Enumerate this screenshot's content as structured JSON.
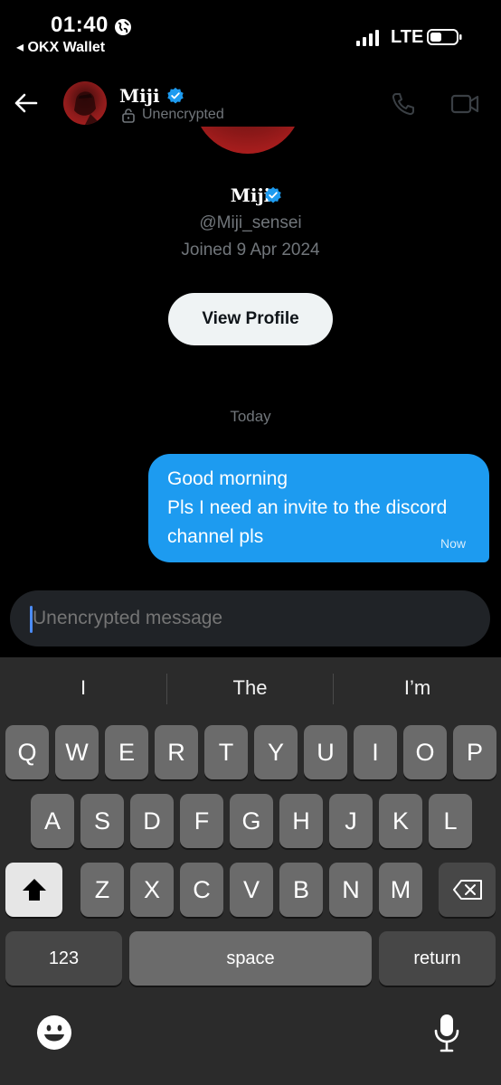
{
  "status_bar": {
    "time": "01:40",
    "back_app": "◂ OKX Wallet",
    "network": "LTE"
  },
  "header": {
    "name": "Miji",
    "subtitle": "Unencrypted"
  },
  "profile": {
    "name": "Miji",
    "handle": "@Miji_sensei",
    "joined": "Joined 9 Apr 2024",
    "view_profile_label": "View Profile"
  },
  "conversation": {
    "date_separator": "Today",
    "messages": [
      {
        "lines": [
          "Good morning",
          "Pls I need an invite to the discord",
          "channel pls"
        ],
        "time": "Now",
        "direction": "outgoing"
      }
    ]
  },
  "composer": {
    "placeholder": "Unencrypted message"
  },
  "keyboard": {
    "suggestions": [
      "I",
      "The",
      "I’m"
    ],
    "row1": [
      "Q",
      "W",
      "E",
      "R",
      "T",
      "Y",
      "U",
      "I",
      "O",
      "P"
    ],
    "row2": [
      "A",
      "S",
      "D",
      "F",
      "G",
      "H",
      "J",
      "K",
      "L"
    ],
    "row3": [
      "Z",
      "X",
      "C",
      "V",
      "B",
      "N",
      "M"
    ],
    "numbers_label": "123",
    "space_label": "space",
    "return_label": "return"
  },
  "colors": {
    "accent": "#1d9bf0",
    "background": "#000000",
    "muted_text": "#71767b",
    "keyboard_bg": "#2b2b2b"
  },
  "icons": [
    "globe-icon",
    "signal-icon",
    "battery-icon",
    "back-arrow-icon",
    "verified-icon",
    "lock-icon",
    "phone-icon",
    "video-icon",
    "shift-icon",
    "backspace-icon",
    "emoji-icon",
    "microphone-icon"
  ]
}
